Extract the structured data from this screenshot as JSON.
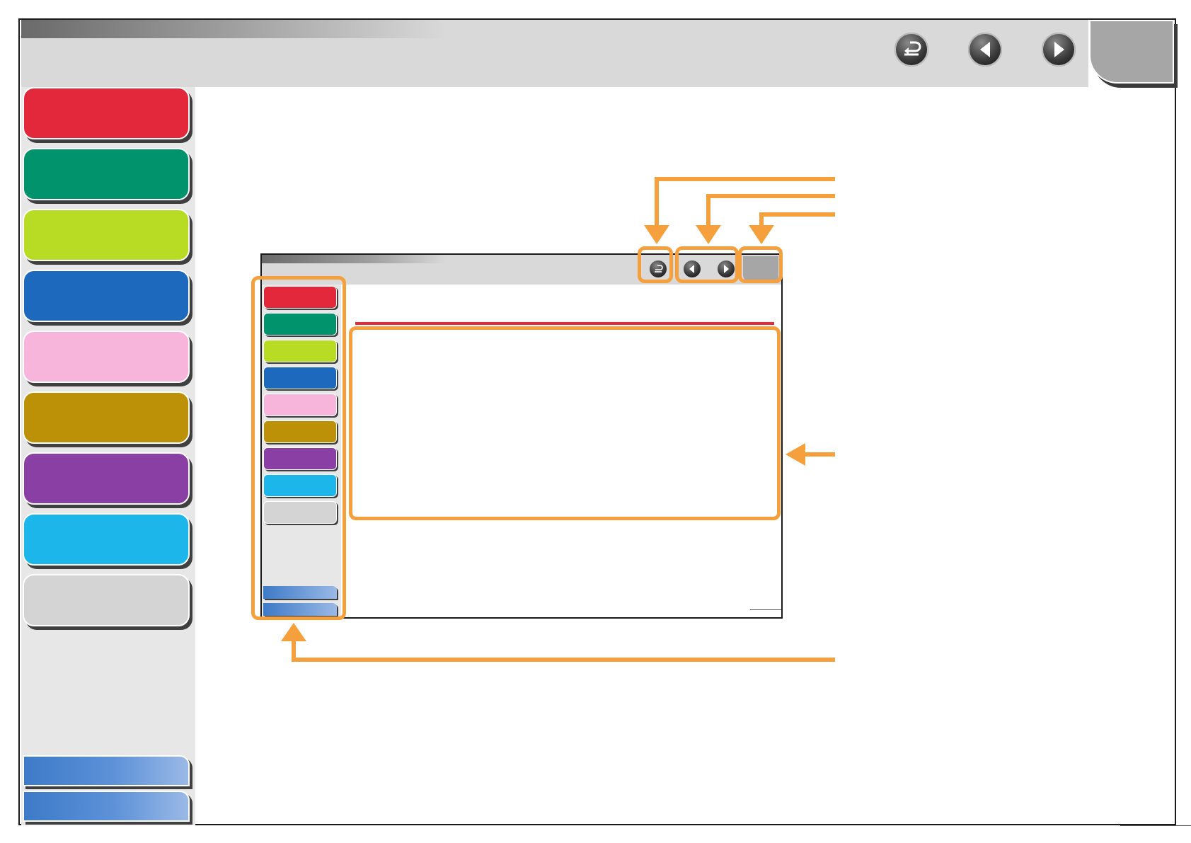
{
  "header": {
    "buttons": [
      {
        "name": "back-button",
        "icon": "return-icon"
      },
      {
        "name": "previous-page-button",
        "icon": "arrow-left-icon"
      },
      {
        "name": "next-page-button",
        "icon": "arrow-right-icon"
      }
    ]
  },
  "sidebar": {
    "chapters": [
      {
        "color": "#e4283c"
      },
      {
        "color": "#00936c"
      },
      {
        "color": "#b8dc24"
      },
      {
        "color": "#1d69bd"
      },
      {
        "color": "#f8b5dc"
      },
      {
        "color": "#bc9007"
      },
      {
        "color": "#8a3fa4"
      },
      {
        "color": "#1cb6ea"
      },
      {
        "color": "#d4d4d4"
      }
    ],
    "bottom_buttons": [
      "",
      ""
    ]
  },
  "illustration": {
    "callout_color": "#f5a03c",
    "mini_redline_color": "#e8293c"
  }
}
